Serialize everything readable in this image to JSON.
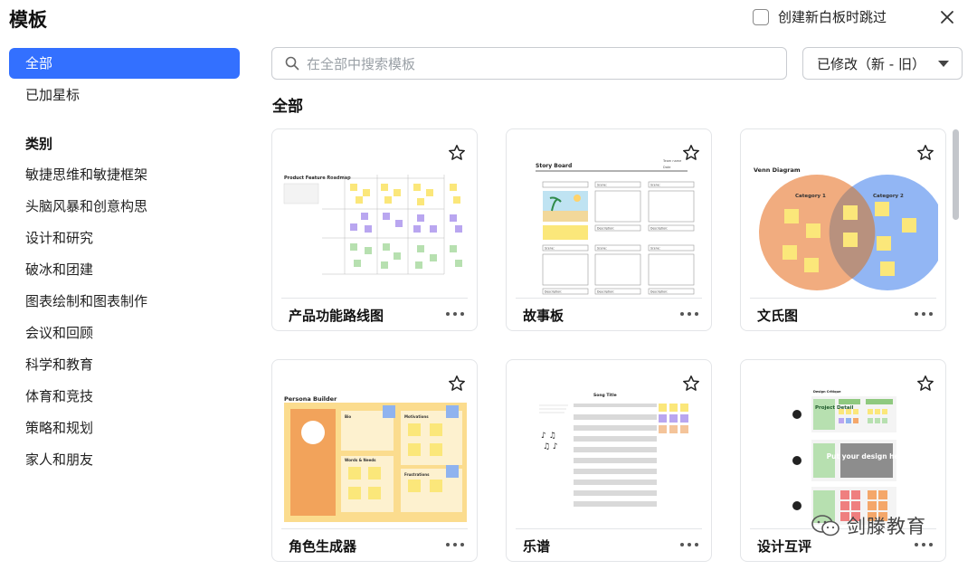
{
  "header": {
    "title": "模板",
    "skip_label": "创建新白板时跳过"
  },
  "sidebar": {
    "all": "全部",
    "starred": "已加星标",
    "category_heading": "类别",
    "categories": [
      "敏捷思维和敏捷框架",
      "头脑风暴和创意构思",
      "设计和研究",
      "破冰和团建",
      "图表绘制和图表制作",
      "会议和回顾",
      "科学和教育",
      "体育和竞技",
      "策略和规划",
      "家人和朋友"
    ]
  },
  "search": {
    "placeholder": "在全部中搜索模板"
  },
  "sort": {
    "label": "已修改（新 - 旧）"
  },
  "section": {
    "title": "全部"
  },
  "templates": [
    {
      "name": "产品功能路线图",
      "thumb_title": "Product Feature Roadmap"
    },
    {
      "name": "故事板",
      "thumb_title": "Story Board",
      "thumb_team": "Team name",
      "thumb_date": "Date",
      "thumb_scene": "Scene:",
      "thumb_desc": "Description:"
    },
    {
      "name": "文氏图",
      "thumb_title": "Venn Diagram",
      "cat1": "Category 1",
      "cat2": "Category 2"
    },
    {
      "name": "角色生成器",
      "thumb_title": "Persona Builder",
      "bio": "Bio",
      "motivations": "Motivations",
      "words": "Words & Needs",
      "frustrations": "Frustrations"
    },
    {
      "name": "乐谱",
      "thumb_title": "Song Title"
    },
    {
      "name": "设计互评",
      "thumb_title": "Design Critique",
      "project": "Project Detail",
      "put": "Put your design here"
    }
  ],
  "watermark": {
    "text": "剑滕教育"
  },
  "colors": {
    "accent": "#3370ff",
    "sticky_yellow": "#fbe77a",
    "sticky_purple": "#b9a6f0",
    "sticky_green": "#b7e0b0",
    "venn_orange": "#f0a878",
    "venn_blue": "#7fa9f2"
  }
}
